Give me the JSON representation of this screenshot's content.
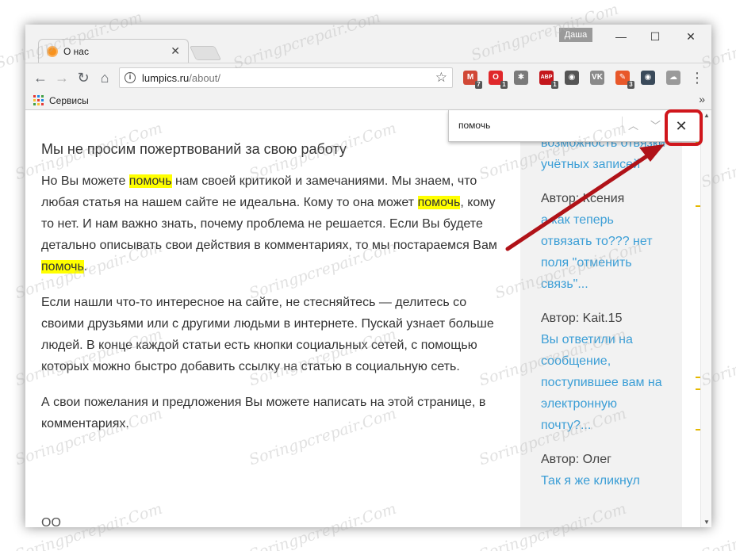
{
  "window": {
    "user_badge": "Даша",
    "controls": {
      "minimize": "—",
      "maximize": "☐",
      "close": "✕"
    }
  },
  "tab": {
    "title": "О нас",
    "close": "✕",
    "favicon": "lumpics-orange-circle-icon"
  },
  "toolbar": {
    "back": "←",
    "forward": "→",
    "reload": "↻",
    "home": "⌂",
    "url_host": "lumpics.ru",
    "url_path": "/about/",
    "info": "i",
    "star": "☆",
    "menu": "⋮"
  },
  "extensions": [
    {
      "name": "gmail-icon",
      "glyph": "M",
      "badge": "7",
      "color": "#d14836"
    },
    {
      "name": "opera-vpn-icon",
      "glyph": "O",
      "badge": "1",
      "color": "#e0282b"
    },
    {
      "name": "paw-icon",
      "glyph": "✱",
      "badge": "",
      "color": "#7a7a7a"
    },
    {
      "name": "adblock-icon",
      "glyph": "ABP",
      "badge": "1",
      "color": "#c4161c"
    },
    {
      "name": "film-icon",
      "glyph": "◉",
      "badge": "",
      "color": "#555555"
    },
    {
      "name": "vk-icon",
      "glyph": "VK",
      "badge": "",
      "color": "#8a8a8a"
    },
    {
      "name": "tool-icon",
      "glyph": "✎",
      "badge": "3",
      "color": "#e8582a"
    },
    {
      "name": "eye-icon",
      "glyph": "◉",
      "badge": "",
      "color": "#3a4a5a"
    },
    {
      "name": "cloud-icon",
      "glyph": "☁",
      "badge": "",
      "color": "#9a9a9a"
    }
  ],
  "bookmarks": {
    "apps_label": "Сервисы",
    "more": "»"
  },
  "find": {
    "query": "помочь",
    "prev": "︿",
    "next": "﹀",
    "close": "✕"
  },
  "article": {
    "heading": "Мы не просим пожертвований за свою работу",
    "p1": [
      "Но Вы можете ",
      "помочь",
      " нам своей критикой и замечаниями. Мы знаем, что любая статья на нашем сайте не идеальна. Кому то она может ",
      "помочь",
      ", кому то нет. И нам важно знать, почему проблема не решается. Если Вы будете детально описывать свои действия в комментариях, то мы постараемся Вам ",
      "помочь",
      "."
    ],
    "p2": "Если нашли что-то интересное на сайте, не стесняйтесь — делитесь со своими друзьями или с другими людьми в интернете. Пускай узнает больше людей. В конце каждой статьи есть кнопки социальных сетей, с помощью которых можно быстро добавить ссылку на статью в социальную сеть.",
    "p3": "А свои пожелания и предложения Вы можете написать на этой странице, в комментариях.",
    "bottom": "ОО"
  },
  "sidebar": {
    "top_link": "возможность отвязки учётных записей",
    "comments": [
      {
        "author": "Автор: Ксения",
        "text": "а как теперь отвязать то??? нет поля \"отменить связь\"..."
      },
      {
        "author": "Автор: Kait.15",
        "text": "Вы ответили на сообщение, поступившее вам на электронную почту?..."
      },
      {
        "author": "Автор: Олег",
        "text": "Так я же кликнул"
      }
    ]
  },
  "watermark": "Soringpcrepair.Com",
  "colors": {
    "highlight": "#ffff00",
    "link": "#3b9ed6",
    "annotation": "#d0161c"
  }
}
